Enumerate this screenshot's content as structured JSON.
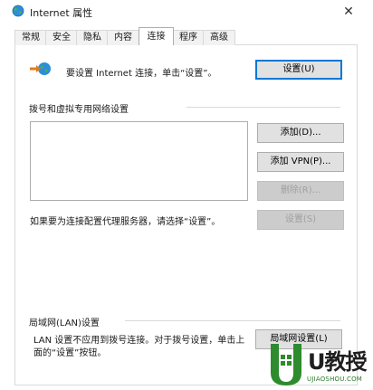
{
  "window": {
    "title": "Internet 属性",
    "close_glyph": "✕"
  },
  "tabs": [
    {
      "label": "常规",
      "active": false
    },
    {
      "label": "安全",
      "active": false
    },
    {
      "label": "隐私",
      "active": false
    },
    {
      "label": "内容",
      "active": false
    },
    {
      "label": "连接",
      "active": true
    },
    {
      "label": "程序",
      "active": false
    },
    {
      "label": "高级",
      "active": false
    }
  ],
  "setup": {
    "text": "要设置 Internet 连接，单击“设置”。",
    "button": "设置(U)"
  },
  "dialup": {
    "group_label": "拨号和虚拟专用网络设置",
    "add_button": "添加(D)...",
    "add_vpn_button": "添加 VPN(P)...",
    "delete_button": "删除(R)...",
    "settings_button": "设置(S)",
    "proxy_hint": "如果要为连接配置代理服务器，请选择“设置”。"
  },
  "lan": {
    "group_label": "局域网(LAN)设置",
    "text_line1": "LAN 设置不应用到拨号连接。对于拨号设置，单击上",
    "text_line2": "面的“设置”按钮。",
    "button": "局域网设置(L)"
  },
  "watermark": {
    "brand": "U教授",
    "site": "UJIAOSHOU.COM"
  },
  "colors": {
    "accent": "#0078d7",
    "watermark_green": "#2e8b2e"
  },
  "icons": {
    "title": "internet-globe-icon",
    "setup": "network-connect-icon",
    "watermark": "windows-shield-logo"
  }
}
